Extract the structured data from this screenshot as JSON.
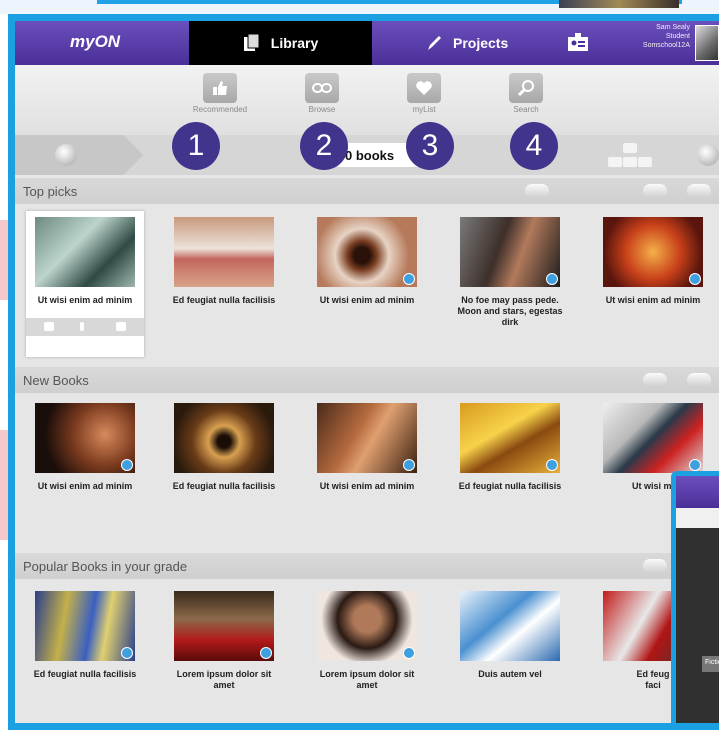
{
  "app": {
    "logo": "myON"
  },
  "nav": {
    "library_label": "Library",
    "projects_label": "Projects",
    "user_lines": [
      "Sam Sealy",
      "Student",
      "Somschool12A"
    ]
  },
  "toolbar": {
    "tools": [
      {
        "label": "Recommended",
        "icon": "thumbs-up-icon"
      },
      {
        "label": "Browse",
        "icon": "chain-icon"
      },
      {
        "label": "myList",
        "icon": "heart-icon"
      },
      {
        "label": "Search",
        "icon": "magnifier-icon"
      }
    ],
    "callouts": [
      "1",
      "2",
      "3",
      "4"
    ]
  },
  "controls": {
    "book_count": "0 books"
  },
  "sections": [
    {
      "title": "Top picks",
      "books": [
        "Ut wisi enim ad minim",
        "Ed feugiat nulla facilisis",
        "Ut wisi enim ad minim",
        "No foe may pass pede. Moon and stars, egestas dirk",
        "Ut wisi enim ad minim"
      ]
    },
    {
      "title": "New Books",
      "books": [
        "Ut wisi enim ad minim",
        "Ed feugiat nulla facilisis",
        "Ut wisi enim ad minim",
        "Ed feugiat nulla facilisis",
        "Ut wisi"
      ],
      "truncated_last": "mi"
    },
    {
      "title": "Popular Books in your grade",
      "books": [
        "Ed feugiat nulla facilisis",
        "Lorem ipsum dolor sit amet",
        "Lorem ipsum dolor sit amet",
        "Duis autem vel",
        "Ed feug"
      ],
      "truncated_last": "faci"
    }
  ],
  "popup": {
    "field_label": "Fiction"
  },
  "colors": {
    "frame": "#1ba1e2",
    "nav": "#4b2f98",
    "callout": "#41348c"
  }
}
